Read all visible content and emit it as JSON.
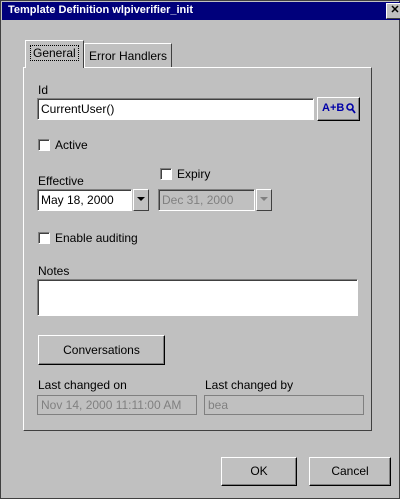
{
  "window": {
    "title": "Template Definition wlpiverifier_init",
    "close_glyph": "✕"
  },
  "tabs": [
    {
      "label": "General",
      "active": true
    },
    {
      "label": "Error Handlers",
      "active": false
    }
  ],
  "form": {
    "id_label": "Id",
    "id_value": "CurrentUser()",
    "expression_button": "A+B",
    "active_label": "Active",
    "active_checked": false,
    "effective_label": "Effective",
    "effective_value": "May 18, 2000",
    "expiry_label": "Expiry",
    "expiry_checked": false,
    "expiry_value": "Dec 31, 2000",
    "enable_auditing_label": "Enable auditing",
    "enable_auditing_checked": false,
    "notes_label": "Notes",
    "notes_value": "",
    "conversations_button": "Conversations",
    "last_changed_on_label": "Last changed on",
    "last_changed_on_value": "Nov 14, 2000 11:11:00 AM",
    "last_changed_by_label": "Last changed by",
    "last_changed_by_value": "bea"
  },
  "footer": {
    "ok_label": "OK",
    "cancel_label": "Cancel"
  },
  "colors": {
    "titlebar": "#00007b",
    "face": "#c0c0c0",
    "field": "#ffffff"
  }
}
